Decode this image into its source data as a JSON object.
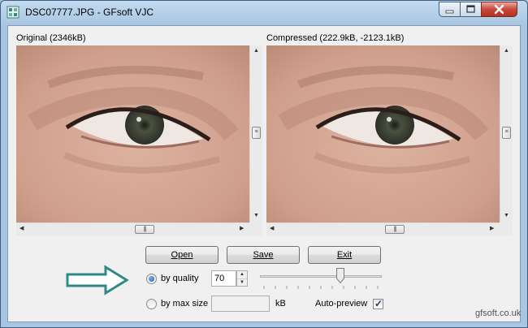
{
  "window": {
    "title": "DSC07777.JPG - GFsoft VJC"
  },
  "panels": {
    "original_label": "Original (2346kB)",
    "compressed_label": "Compressed (222.9kB, -2123.1kB)"
  },
  "buttons": {
    "open": "Open",
    "save": "Save",
    "exit": "Exit"
  },
  "options": {
    "by_quality_label": "by quality",
    "by_quality_selected": true,
    "quality_value": "70",
    "quality_slider_fraction": 0.67,
    "by_max_size_label": "by max size",
    "max_size_value": "",
    "size_unit": "kB",
    "auto_preview_label": "Auto-preview",
    "auto_preview_checked": true
  },
  "footer": {
    "credit": "gfsoft.co.uk"
  },
  "icons": {
    "app": "app-icon",
    "minimize": "minimize-icon",
    "maximize": "maximize-icon",
    "close": "close-icon",
    "hint_arrow": "arrow-right-icon"
  },
  "colors": {
    "titlebar": "#a8c6e2",
    "close_button": "#c9473b",
    "hint_arrow": "#2f8a86",
    "client": "#f0f0f0"
  }
}
